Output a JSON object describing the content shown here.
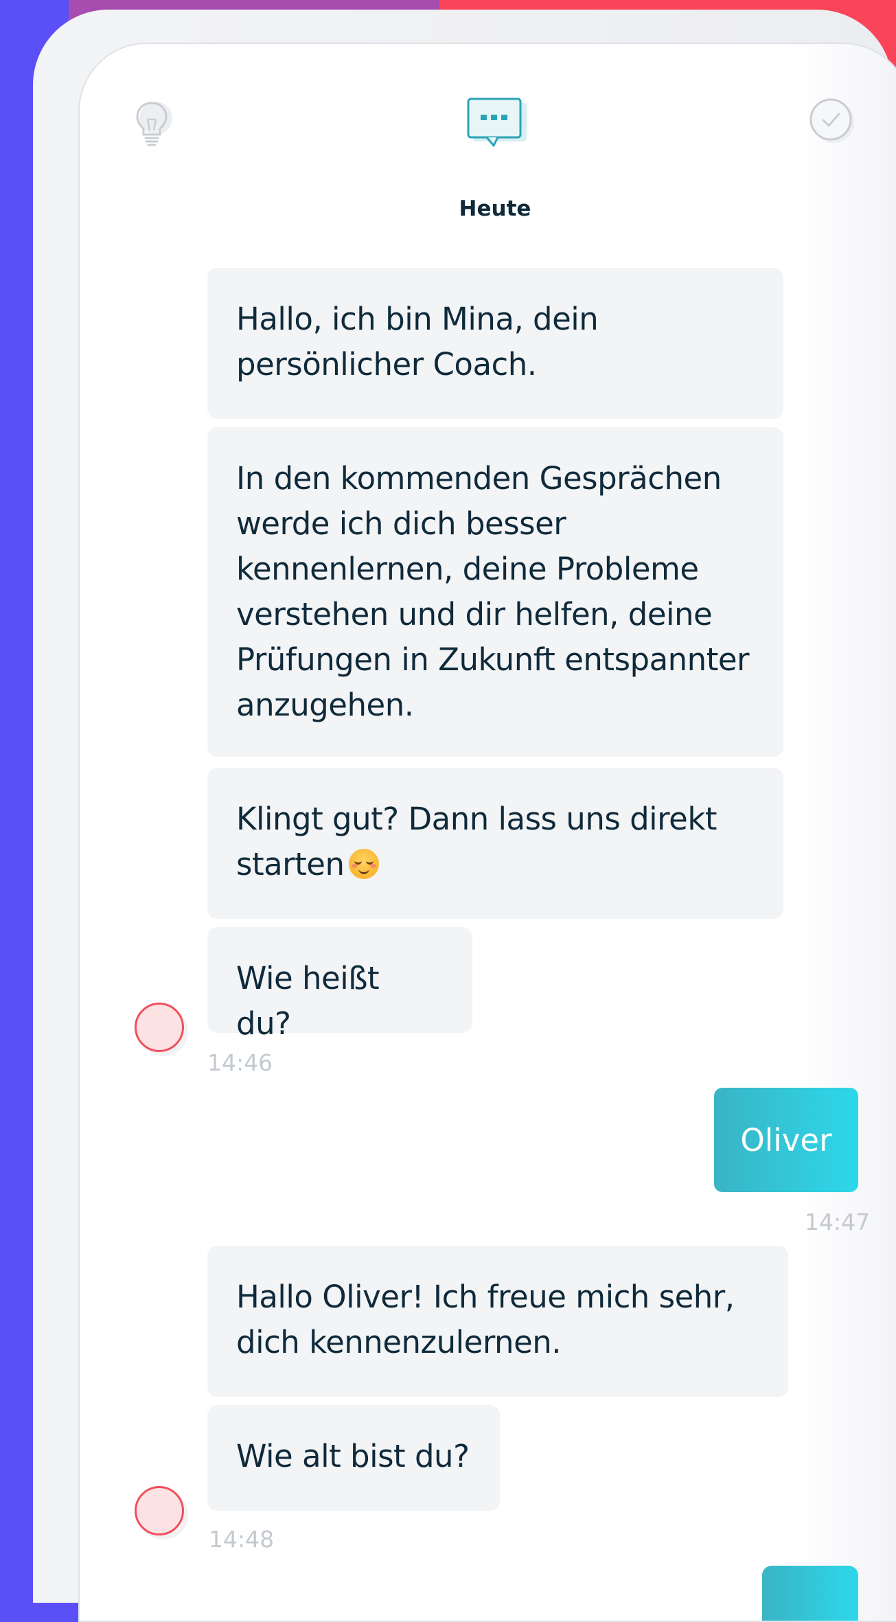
{
  "header": {
    "left_icon": "lightbulb-icon",
    "center_icon": "chat-bubble-icon",
    "right_icon": "checkmark-circle-icon"
  },
  "chat": {
    "date_label": "Heute",
    "messages": [
      {
        "sender": "coach",
        "text": "Hallo, ich bin Mina, dein\npersönlicher Coach."
      },
      {
        "sender": "coach",
        "text": "In den kommenden Gesprächen\nwerde ich dich besser\nkennenlernen, deine Probleme\nverstehen und dir helfen, deine\nPrüfungen in Zukunft entspannter\nanzugehen."
      },
      {
        "sender": "coach",
        "text": "Klingt gut? Dann lass uns direkt\nstarten",
        "emoji": "smiling-face-emoji"
      },
      {
        "sender": "coach",
        "text": "Wie heißt du?",
        "time": "14:46"
      },
      {
        "sender": "user",
        "text": "Oliver",
        "time": "14:47"
      },
      {
        "sender": "coach",
        "text": "Hallo Oliver! Ich freue mich sehr,\ndich kennenzulernen."
      },
      {
        "sender": "coach",
        "text": "Wie alt bist du?",
        "time": "14:48"
      }
    ]
  },
  "colors": {
    "background_purple": "#5b4ff8",
    "background_red": "#fa4459",
    "coach_bubble": "#f3f4f6",
    "user_bubble_start": "#3ab4c4",
    "user_bubble_end": "#2cd8ea",
    "text_dark": "#0f2a3a",
    "avatar_red": "#f0505e",
    "timestamp": "#c4c9cf"
  }
}
